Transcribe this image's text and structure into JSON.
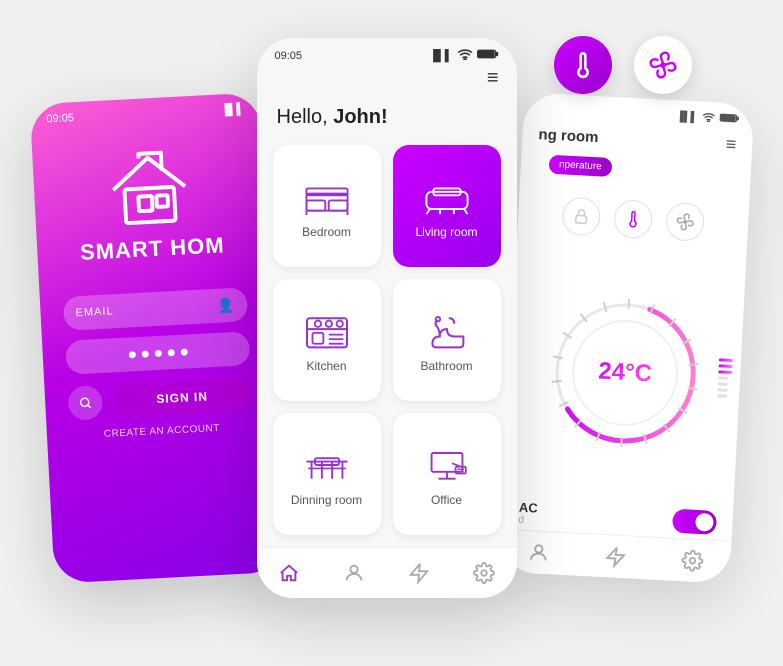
{
  "app": {
    "title": "Smart Home",
    "brand": "SMART HOM"
  },
  "left_phone": {
    "time": "09:05",
    "email_placeholder": "EMAIL",
    "signin_label": "SIGN IN",
    "create_account_label": "CREATE AN ACCOUNT"
  },
  "center_phone": {
    "time": "09:05",
    "greeting": "Hello, ",
    "user": "John!",
    "menu_icon": "≡",
    "rooms": [
      {
        "id": "bedroom",
        "label": "Bedroom",
        "active": false
      },
      {
        "id": "living-room",
        "label": "Living room",
        "active": true
      },
      {
        "id": "kitchen",
        "label": "Kitchen",
        "active": false
      },
      {
        "id": "bathroom",
        "label": "Bathroom",
        "active": false
      },
      {
        "id": "dinning-room",
        "label": "Dinning room",
        "active": false
      },
      {
        "id": "office",
        "label": "Office",
        "active": false
      }
    ],
    "nav": [
      "home",
      "person",
      "lightning",
      "settings"
    ]
  },
  "right_phone": {
    "room_title": "ng room",
    "tab_label": "nperature",
    "temperature": "24°C",
    "ac_label": "AC",
    "ac_sub": "d"
  },
  "float_icons": {
    "thermometer_label": "thermometer-icon",
    "fan_label": "fan-icon"
  }
}
